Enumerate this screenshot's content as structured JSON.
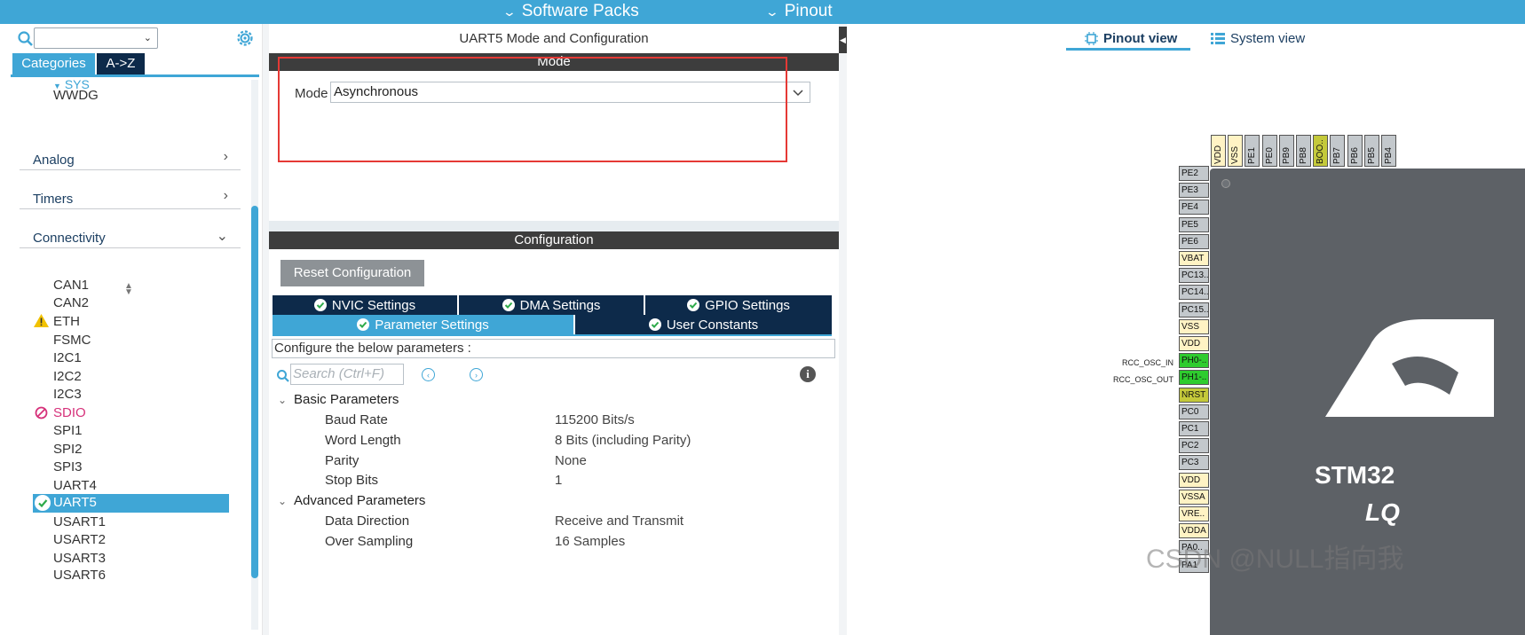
{
  "topbar": {
    "software_packs": "Software Packs",
    "pinout": "Pinout"
  },
  "left_panel": {
    "search": {
      "value": ""
    },
    "tabs": {
      "categories": "Categories",
      "az": "A->Z"
    },
    "partial_item": "SYS",
    "system_items": [
      "WWDG"
    ],
    "groups": {
      "analog": "Analog",
      "timers": "Timers",
      "connectivity": "Connectivity"
    },
    "connectivity_items": [
      {
        "label": "CAN1",
        "status": "none"
      },
      {
        "label": "CAN2",
        "status": "none"
      },
      {
        "label": "ETH",
        "status": "warning"
      },
      {
        "label": "FSMC",
        "status": "none"
      },
      {
        "label": "I2C1",
        "status": "none"
      },
      {
        "label": "I2C2",
        "status": "none"
      },
      {
        "label": "I2C3",
        "status": "none"
      },
      {
        "label": "SDIO",
        "status": "disabled"
      },
      {
        "label": "SPI1",
        "status": "none"
      },
      {
        "label": "SPI2",
        "status": "none"
      },
      {
        "label": "SPI3",
        "status": "none"
      },
      {
        "label": "UART4",
        "status": "none"
      },
      {
        "label": "UART5",
        "status": "selected"
      },
      {
        "label": "USART1",
        "status": "none"
      },
      {
        "label": "USART2",
        "status": "none"
      },
      {
        "label": "USART3",
        "status": "none"
      },
      {
        "label": "USART6",
        "status": "none"
      }
    ],
    "colors": {
      "accent": "#3fa6d6",
      "dark_tab": "#0d2a4a",
      "disabled": "#d6317a",
      "warning": "#f2c200"
    }
  },
  "middle_panel": {
    "title": "UART5 Mode and Configuration",
    "mode_section": "Mode",
    "mode_label": "Mode",
    "mode_value": "Asynchronous",
    "config_section": "Configuration",
    "reset_button": "Reset Configuration",
    "tabs": {
      "nvic": "NVIC Settings",
      "dma": "DMA Settings",
      "gpio": "GPIO Settings",
      "parameter": "Parameter Settings",
      "user_constants": "User Constants"
    },
    "hint": "Configure the below parameters :",
    "search_placeholder": "Search (Ctrl+F)",
    "basic": {
      "title": "Basic Parameters",
      "params": [
        {
          "name": "Baud Rate",
          "value": "115200 Bits/s"
        },
        {
          "name": "Word Length",
          "value": "8 Bits (including Parity)"
        },
        {
          "name": "Parity",
          "value": "None"
        },
        {
          "name": "Stop Bits",
          "value": "1"
        }
      ]
    },
    "advanced": {
      "title": "Advanced Parameters",
      "params": [
        {
          "name": "Data Direction",
          "value": "Receive and Transmit"
        },
        {
          "name": "Over Sampling",
          "value": "16 Samples"
        }
      ]
    }
  },
  "right_panel": {
    "pinout_view": "Pinout view",
    "system_view": "System view",
    "left_pins": [
      {
        "label": "PE2",
        "color": "#c3c8cc"
      },
      {
        "label": "PE3",
        "color": "#c3c8cc"
      },
      {
        "label": "PE4",
        "color": "#c3c8cc"
      },
      {
        "label": "PE5",
        "color": "#c3c8cc"
      },
      {
        "label": "PE6",
        "color": "#c3c8cc"
      },
      {
        "label": "VBAT",
        "color": "#fff3c4"
      },
      {
        "label": "PC13..",
        "color": "#c3c8cc"
      },
      {
        "label": "PC14..",
        "color": "#c3c8cc"
      },
      {
        "label": "PC15..",
        "color": "#c3c8cc"
      },
      {
        "label": "VSS",
        "color": "#fff3c4"
      },
      {
        "label": "VDD",
        "color": "#fff3c4"
      },
      {
        "label": "PH0-..",
        "color": "#2ecc2e"
      },
      {
        "label": "PH1-..",
        "color": "#2ecc2e"
      },
      {
        "label": "NRST",
        "color": "#c4c93a"
      },
      {
        "label": "PC0",
        "color": "#c3c8cc"
      },
      {
        "label": "PC1",
        "color": "#c3c8cc"
      },
      {
        "label": "PC2",
        "color": "#c3c8cc"
      },
      {
        "label": "PC3",
        "color": "#c3c8cc"
      },
      {
        "label": "VDD",
        "color": "#fff3c4"
      },
      {
        "label": "VSSA",
        "color": "#fff3c4"
      },
      {
        "label": "VRE..",
        "color": "#fff3c4"
      },
      {
        "label": "VDDA",
        "color": "#fff3c4"
      },
      {
        "label": "PA0..",
        "color": "#c3c8cc"
      },
      {
        "label": "PA1",
        "color": "#c3c8cc"
      }
    ],
    "top_pins": [
      {
        "label": "VDD",
        "color": "#fff3c4"
      },
      {
        "label": "VSS",
        "color": "#fff3c4"
      },
      {
        "label": "PE1",
        "color": "#c3c8cc"
      },
      {
        "label": "PE0",
        "color": "#c3c8cc"
      },
      {
        "label": "PB9",
        "color": "#c3c8cc"
      },
      {
        "label": "PB8",
        "color": "#c3c8cc"
      },
      {
        "label": "BOO..",
        "color": "#c4c93a"
      },
      {
        "label": "PB7",
        "color": "#c3c8cc"
      },
      {
        "label": "PB6",
        "color": "#c3c8cc"
      },
      {
        "label": "PB5",
        "color": "#c3c8cc"
      },
      {
        "label": "PB4",
        "color": "#c3c8cc"
      }
    ],
    "signal_labels": {
      "osc_in": "RCC_OSC_IN",
      "osc_out": "RCC_OSC_OUT"
    },
    "chip_text_1": "STM32",
    "chip_text_2": "LQ"
  },
  "watermark": "CSDN @NULL指向我"
}
